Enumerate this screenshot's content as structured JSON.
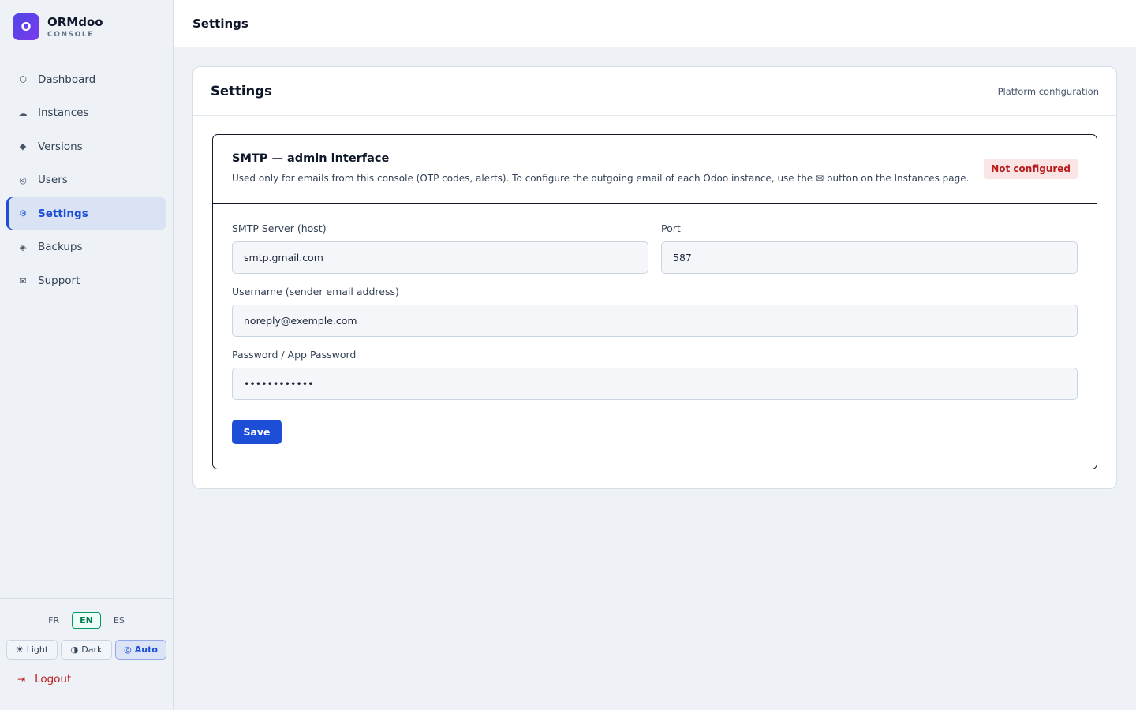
{
  "brand": {
    "logo_letter": "O",
    "name": "ORMdoo",
    "subtitle": "CONSOLE"
  },
  "sidebar": {
    "items": [
      {
        "label": "Dashboard",
        "icon": "⬡",
        "icon_name": "hexagon-icon",
        "active": false
      },
      {
        "label": "Instances",
        "icon": "☁",
        "icon_name": "cloud-icon",
        "active": false
      },
      {
        "label": "Versions",
        "icon": "◆",
        "icon_name": "diamond-icon",
        "active": false
      },
      {
        "label": "Users",
        "icon": "◎",
        "icon_name": "user-circle-icon",
        "active": false
      },
      {
        "label": "Settings",
        "icon": "⚙",
        "icon_name": "gear-icon",
        "active": true
      },
      {
        "label": "Backups",
        "icon": "◈",
        "icon_name": "backup-icon",
        "active": false
      },
      {
        "label": "Support",
        "icon": "✉",
        "icon_name": "mail-icon",
        "active": false
      }
    ],
    "languages": [
      "FR",
      "EN",
      "ES"
    ],
    "active_language": "EN",
    "themes": [
      {
        "label": "Light",
        "icon": "☀",
        "active": false
      },
      {
        "label": "Dark",
        "icon": "◑",
        "active": false
      },
      {
        "label": "Auto",
        "icon": "◎",
        "active": true
      }
    ],
    "logout": {
      "label": "Logout",
      "icon": "⇥"
    }
  },
  "topbar": {
    "title": "Settings"
  },
  "card": {
    "title": "Settings",
    "subtitle": "Platform configuration",
    "smtp": {
      "title": "SMTP — admin interface",
      "description": "Used only for emails from this console (OTP codes, alerts). To configure the outgoing email of each Odoo instance, use the ✉ button on the Instances page.",
      "badge": "Not configured",
      "host_label": "SMTP Server (host)",
      "host_value": "smtp.gmail.com",
      "port_label": "Port",
      "port_value": "587",
      "username_label": "Username (sender email address)",
      "username_value": "noreply@exemple.com",
      "password_label": "Password / App Password",
      "password_value": "••••••••••••",
      "save_label": "Save"
    }
  },
  "colors": {
    "accent": "#1d4ed8",
    "badge_bg": "#fbe4e4",
    "badge_text": "#b91c1c",
    "logout": "#b91c1c"
  }
}
